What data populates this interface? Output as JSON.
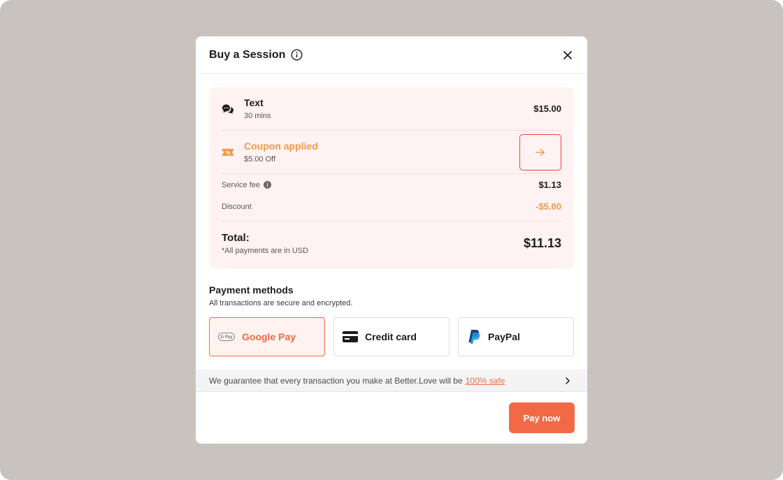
{
  "modal": {
    "title": "Buy a Session"
  },
  "summary": {
    "item": {
      "title": "Text",
      "duration": "30 mins",
      "price": "$15.00",
      "icon": "chat-bubbles-icon"
    },
    "coupon": {
      "title": "Coupon applied",
      "detail": "$5.00 Off",
      "icon": "coupon-icon"
    },
    "service_fee": {
      "label": "Service fee",
      "value": "$1.13"
    },
    "discount": {
      "label": "Discount",
      "value": "-$5.00"
    },
    "total": {
      "label": "Total:",
      "note": "*All payments are in USD",
      "value": "$11.13"
    }
  },
  "payment": {
    "title": "Payment methods",
    "subtitle": "All transactions are secure and encrypted.",
    "options": [
      {
        "label": "Google Pay",
        "badge": "G Pay",
        "selected": true
      },
      {
        "label": "Credit card",
        "selected": false
      },
      {
        "label": "PayPal",
        "selected": false
      }
    ]
  },
  "guarantee": {
    "text": "We guarantee that every transaction you make at Better.Love will be",
    "link": "100% safe"
  },
  "footer": {
    "pay_label": "Pay now"
  },
  "colors": {
    "accent": "#f26a45",
    "coupon": "#f2994a",
    "summary_bg": "#fff2f2",
    "backdrop": "#c9c3bf"
  }
}
